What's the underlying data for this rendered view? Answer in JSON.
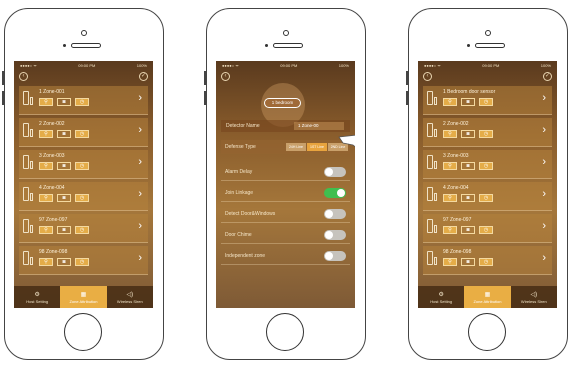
{
  "status": {
    "time": "09:00 PM",
    "battery": "100%"
  },
  "tabs": [
    {
      "label": "Host Setting",
      "icon": "⚙"
    },
    {
      "label": "Zone Attribution",
      "icon": "▦"
    },
    {
      "label": "Wireless Siren",
      "icon": "◁)"
    }
  ],
  "zone_icons": [
    "⚲",
    "◙",
    "◷"
  ],
  "left_zones": [
    {
      "name": "1 Zone-001"
    },
    {
      "name": "2 Zone-002"
    },
    {
      "name": "3 Zone-003"
    },
    {
      "name": "4 Zone-004"
    },
    {
      "name": "97 Zone-097"
    },
    {
      "name": "98 Zone-098"
    }
  ],
  "right_zones": [
    {
      "name": "1 Bedroom door sensor"
    },
    {
      "name": "2 Zone-002"
    },
    {
      "name": "3 Zone-003"
    },
    {
      "name": "4 Zone-004"
    },
    {
      "name": "97 Zone-097"
    },
    {
      "name": "98 Zone-098"
    }
  ],
  "detail": {
    "bubble_label": "1 bedroom",
    "detector_label": "Detector Name",
    "detector_value": "1 Zone-00",
    "defense_label": "Defense Type",
    "defense_options": [
      "24H Line",
      "1ST Line",
      "2ND Line"
    ],
    "settings": [
      {
        "label": "Alarm Delay",
        "on": false
      },
      {
        "label": "Join Linkage",
        "on": true
      },
      {
        "label": "Detect Door&Windows",
        "on": false
      },
      {
        "label": "Door Chime",
        "on": false
      },
      {
        "label": "Independent zone",
        "on": false
      }
    ]
  }
}
